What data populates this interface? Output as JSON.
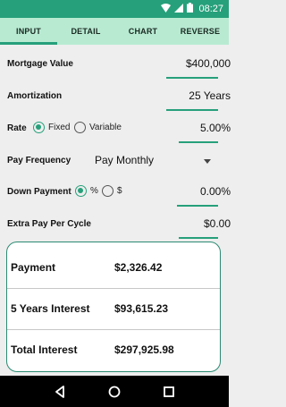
{
  "status_bar": {
    "time": "08:27"
  },
  "tabs": [
    {
      "label": "INPUT"
    },
    {
      "label": "DETAIL"
    },
    {
      "label": "CHART"
    },
    {
      "label": "REVERSE"
    }
  ],
  "form": {
    "mortgage_value": {
      "label": "Mortgage Value",
      "value": "$400,000"
    },
    "amortization": {
      "label": "Amortization",
      "value": "25 Years"
    },
    "rate": {
      "label": "Rate",
      "option_fixed": "Fixed",
      "option_variable": "Variable",
      "value": "5.00%"
    },
    "pay_frequency": {
      "label": "Pay Frequency",
      "selected": "Pay Monthly"
    },
    "down_payment": {
      "label": "Down Payment",
      "option_percent": "%",
      "option_dollar": "$",
      "value": "0.00%"
    },
    "extra_pay": {
      "label": "Extra Pay Per Cycle",
      "value": "$0.00"
    }
  },
  "results": [
    {
      "label": "Payment",
      "value": "$2,326.42"
    },
    {
      "label": "5 Years Interest",
      "value": "$93,615.23"
    },
    {
      "label": "Total Interest",
      "value": "$297,925.98"
    }
  ],
  "colors": {
    "accent": "#26a07a",
    "tab_bg": "#b8ead2",
    "card_border": "#2a8a72"
  }
}
